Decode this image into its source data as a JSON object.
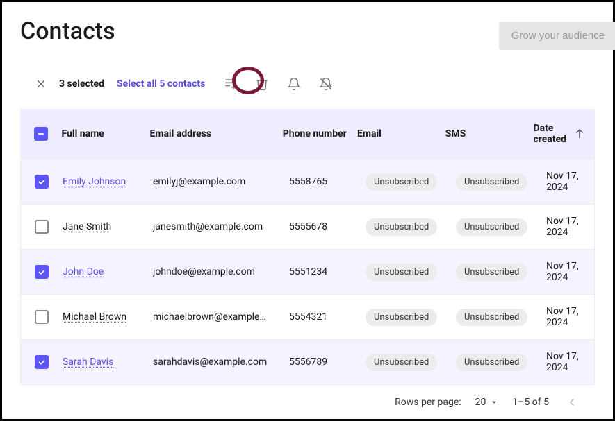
{
  "header": {
    "title": "Contacts",
    "grow_button": "Grow your audience"
  },
  "action_bar": {
    "selected_count": "3 selected",
    "select_all": "Select all 5 contacts"
  },
  "columns": {
    "name": "Full name",
    "email": "Email address",
    "phone": "Phone number",
    "email_status": "Email",
    "sms": "SMS",
    "date": "Date created"
  },
  "rows": [
    {
      "selected": true,
      "name": "Emily Johnson",
      "email": "emilyj@example.com",
      "phone": "5558765",
      "email_status": "Unsubscribed",
      "sms": "Unsubscribed",
      "date": "Nov 17, 2024"
    },
    {
      "selected": false,
      "name": "Jane Smith",
      "email": "janesmith@example.com",
      "phone": "5555678",
      "email_status": "Unsubscribed",
      "sms": "Unsubscribed",
      "date": "Nov 17, 2024"
    },
    {
      "selected": true,
      "name": "John Doe",
      "email": "johndoe@example.com",
      "phone": "5551234",
      "email_status": "Unsubscribed",
      "sms": "Unsubscribed",
      "date": "Nov 17, 2024"
    },
    {
      "selected": false,
      "name": "Michael Brown",
      "email": "michaelbrown@example…",
      "phone": "5554321",
      "email_status": "Unsubscribed",
      "sms": "Unsubscribed",
      "date": "Nov 17, 2024"
    },
    {
      "selected": true,
      "name": "Sarah Davis",
      "email": "sarahdavis@example.com",
      "phone": "5556789",
      "email_status": "Unsubscribed",
      "sms": "Unsubscribed",
      "date": "Nov 17, 2024"
    }
  ],
  "footer": {
    "rows_per_page_label": "Rows per page:",
    "rows_per_page_value": "20",
    "range": "1–5 of 5"
  }
}
